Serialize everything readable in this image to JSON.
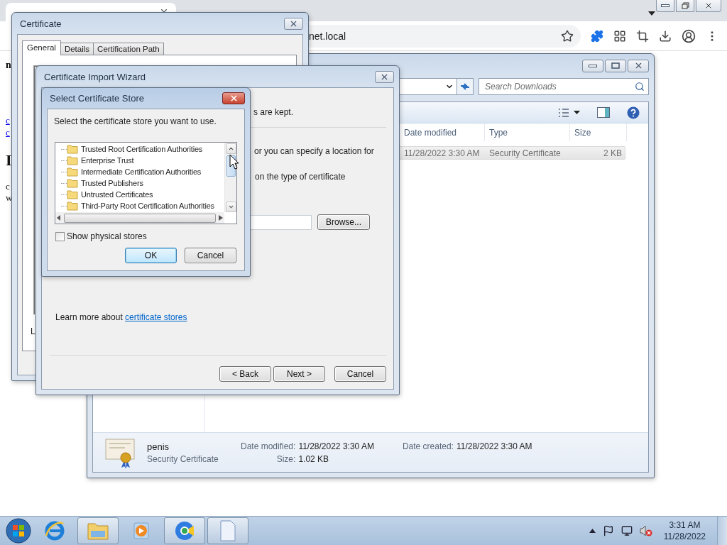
{
  "browser": {
    "address": "net.local",
    "page_fragments": [
      {
        "text": "n",
        "kind": "bold"
      },
      {
        "text": "c",
        "kind": "link"
      },
      {
        "text": "c",
        "kind": "link"
      },
      {
        "text": "I",
        "kind": "heading"
      },
      {
        "text": "c",
        "kind": "plain"
      },
      {
        "text": "w",
        "kind": "plain"
      }
    ]
  },
  "explorer": {
    "search": {
      "placeholder": "Search Downloads"
    },
    "columns": [
      "Date modified",
      "Type",
      "Size"
    ],
    "rows": [
      {
        "date_modified": "11/28/2022 3:30 AM",
        "type": "Security Certificate",
        "size": "2 KB",
        "selected": true
      }
    ],
    "details": {
      "name": "penis",
      "type": "Security Certificate",
      "fields": [
        {
          "label": "Date modified:",
          "value": "11/28/2022 3:30 AM"
        },
        {
          "label": "Size:",
          "value": "1.02 KB"
        },
        {
          "label": "Date created:",
          "value": "11/28/2022 3:30 AM"
        }
      ]
    }
  },
  "certificate": {
    "title": "Certificate",
    "tabs": [
      {
        "label": "General",
        "selected": true
      },
      {
        "label": "Details",
        "selected": false
      },
      {
        "label": "Certification Path",
        "selected": false
      }
    ],
    "footer_fragment": "L"
  },
  "wizard": {
    "title": "Certificate Import Wizard",
    "header_fragment": "s are kept.",
    "lines": [
      "or you can specify a location for",
      "on the type of certificate"
    ],
    "browse": "Browse...",
    "learn_more": {
      "text": "Learn more about",
      "link": "certificate stores"
    },
    "buttons": [
      {
        "label": "< Back"
      },
      {
        "label": "Next >"
      },
      {
        "label": "Cancel"
      }
    ]
  },
  "store_dialog": {
    "title": "Select Certificate Store",
    "prompt": "Select the certificate store you want to use.",
    "stores": [
      {
        "label": "Trusted Root Certification Authorities",
        "selected": false
      },
      {
        "label": "Enterprise Trust",
        "selected": false
      },
      {
        "label": "Intermediate Certification Authorities",
        "selected": false
      },
      {
        "label": "Trusted Publishers",
        "selected": false
      },
      {
        "label": "Untrusted Certificates",
        "selected": false
      },
      {
        "label": "Third-Party Root Certification Authorities",
        "selected": false
      }
    ],
    "show_physical": {
      "label": "Show physical stores",
      "checked": false
    },
    "buttons": [
      {
        "label": "OK",
        "default": true
      },
      {
        "label": "Cancel",
        "default": false
      }
    ]
  },
  "taskbar": {
    "apps": [
      {
        "kind": "ie",
        "active": false
      },
      {
        "kind": "explorer",
        "active": true
      },
      {
        "kind": "media",
        "active": false
      },
      {
        "kind": "chrome",
        "active": true
      },
      {
        "kind": "document",
        "active": true
      }
    ],
    "clock": {
      "time": "3:31 AM",
      "date": "11/28/2022"
    }
  }
}
